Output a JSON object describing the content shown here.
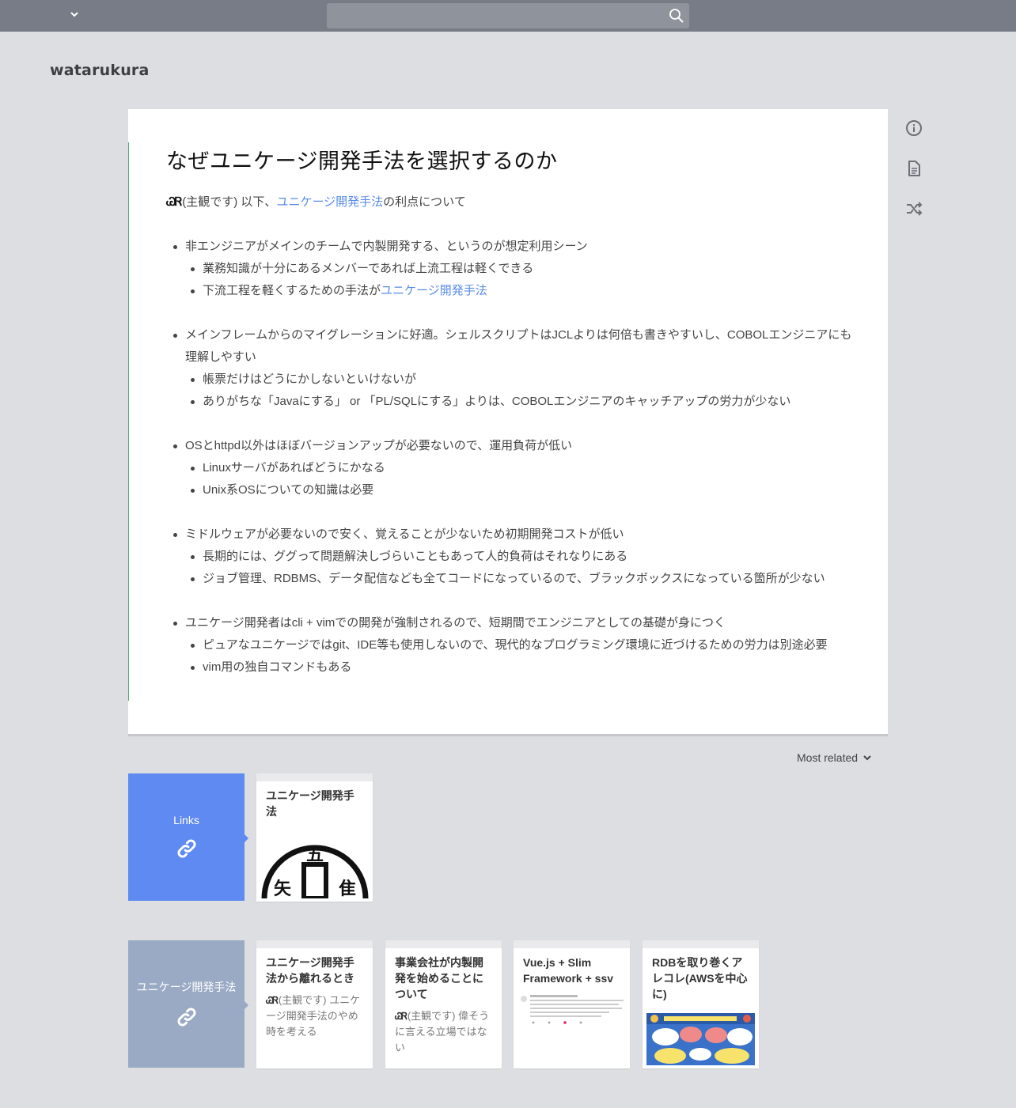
{
  "header": {
    "search_placeholder": ""
  },
  "project": {
    "name": "watarukura"
  },
  "page": {
    "title": "なぜユニケージ開発手法を選択するのか",
    "lead": {
      "mark": "ᏊᏒ",
      "before": "(主観です) 以下、",
      "link": "ユニケージ開発手法",
      "after": "の利点について"
    },
    "items": [
      {
        "level": 1,
        "text": "非エンジニアがメインのチームで内製開発する、というのが想定利用シーン"
      },
      {
        "level": 2,
        "text": "業務知識が十分にあるメンバーであれば上流工程は軽くできる"
      },
      {
        "level": 2,
        "text": "下流工程を軽くするための手法が",
        "link": "ユニケージ開発手法"
      },
      {
        "level": 0
      },
      {
        "level": 1,
        "text": "メインフレームからのマイグレーションに好適。シェルスクリプトはJCLよりは何倍も書きやすいし、COBOLエンジニアにも理解しやすい"
      },
      {
        "level": 2,
        "text": "帳票だけはどうにかしないといけないが"
      },
      {
        "level": 2,
        "text": "ありがちな「Javaにする」 or 「PL/SQLにする」よりは、COBOLエンジニアのキャッチアップの労力が少ない"
      },
      {
        "level": 0
      },
      {
        "level": 1,
        "text": "OSとhttpd以外はほぼバージョンアップが必要ないので、運用負荷が低い"
      },
      {
        "level": 2,
        "text": "Linuxサーバがあればどうにかなる"
      },
      {
        "level": 2,
        "text": "Unix系OSについての知識は必要"
      },
      {
        "level": 0
      },
      {
        "level": 1,
        "text": "ミドルウェアが必要ないので安く、覚えることが少ないため初期開発コストが低い"
      },
      {
        "level": 2,
        "text": "長期的には、ググって問題解決しづらいこともあって人的負荷はそれなりにある"
      },
      {
        "level": 2,
        "text": "ジョブ管理、RDBMS、データ配信なども全てコードになっているので、ブラックボックスになっている箇所が少ない"
      },
      {
        "level": 0
      },
      {
        "level": 1,
        "text": "ユニケージ開発者はcli + vimでの開発が強制されるので、短期間でエンジニアとしての基礎が身につく"
      },
      {
        "level": 2,
        "text": "ピュアなユニケージではgit、IDE等も使用しないので、現代的なプログラミング環境に近づけるための労力は別途必要"
      },
      {
        "level": 2,
        "text": "vim用の独自コマンドもある"
      }
    ]
  },
  "sort": {
    "label": "Most related"
  },
  "related": {
    "links_label": "Links",
    "links_color": "#5e8af2",
    "links_cards": [
      {
        "title": "ユニケージ開発手法",
        "image": "unicage-logo"
      }
    ],
    "tag_label": "ユニケージ開発手法",
    "tag_color": "#9aaac4",
    "tag_cards": [
      {
        "title": "ユニケージ開発手法から離れるとき",
        "mark": "ᏊᏒ",
        "excerpt": "(主観です) ユニケージ開発手法のやめ時を考える"
      },
      {
        "title": "事業会社が内製開発を始めることについて",
        "mark": "ᏊᏒ",
        "excerpt": "(主観です) 偉そうに言える立場ではない"
      },
      {
        "title": "Vue.js + Slim Framework + ssv",
        "image": "tweet-screenshot"
      },
      {
        "title": "RDBを取り巻くアレコレ(AWSを中心に)",
        "image": "bigtable-vs-bigquery"
      }
    ]
  }
}
